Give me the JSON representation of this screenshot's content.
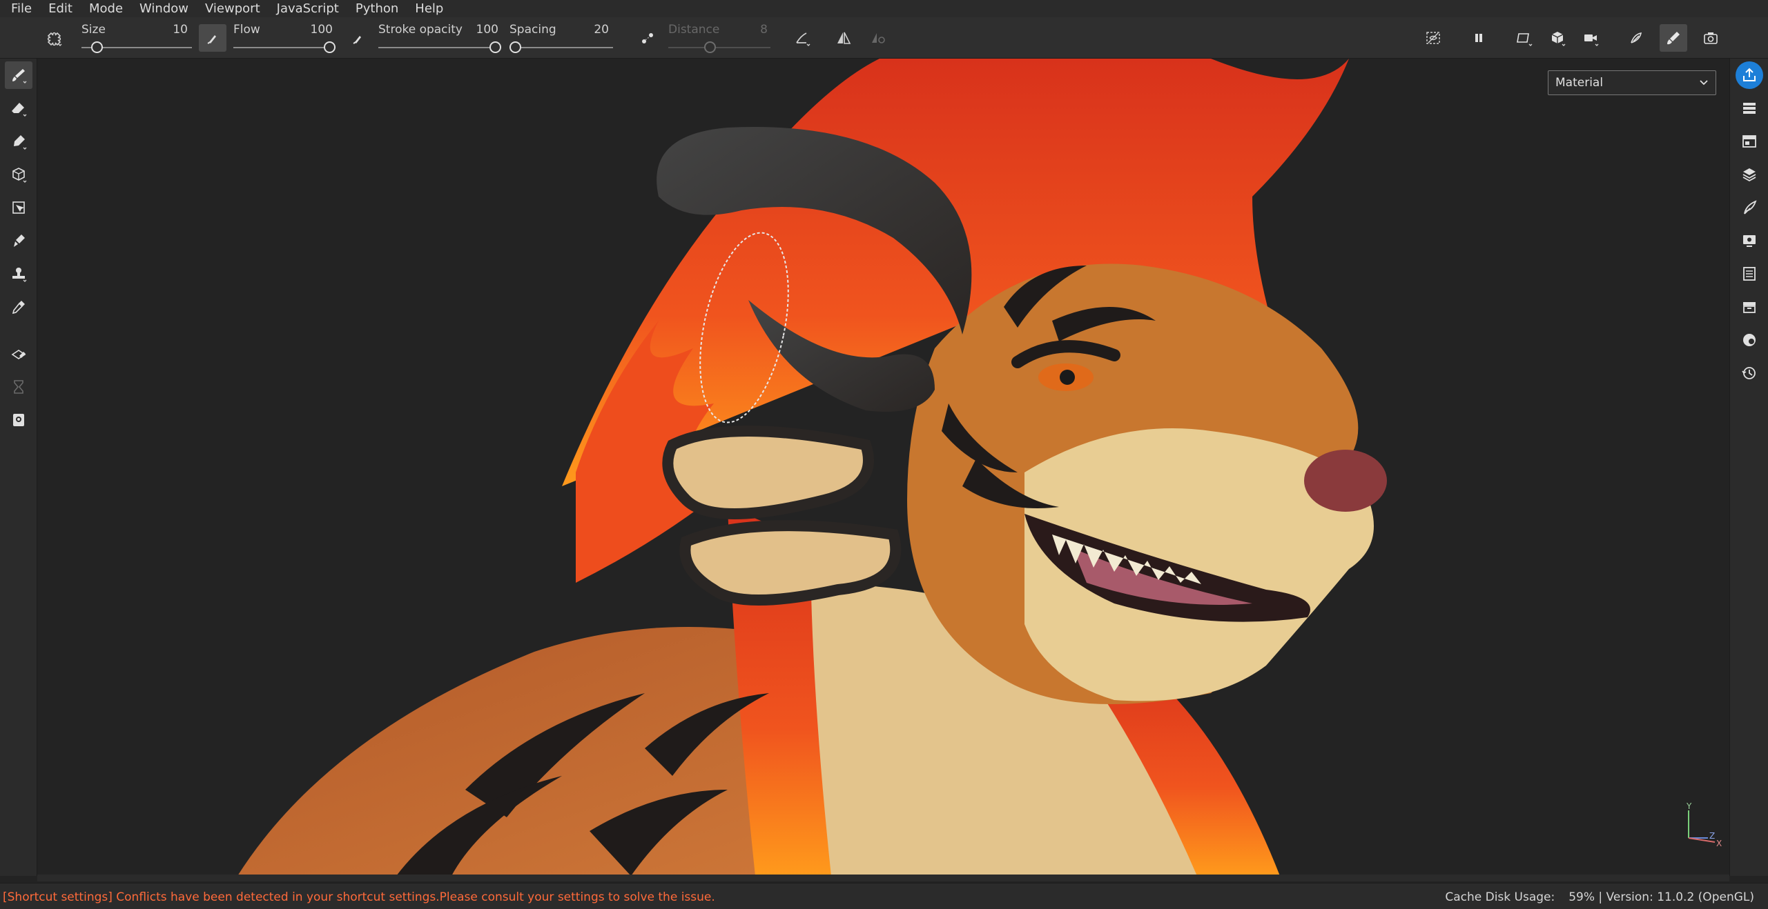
{
  "menu": [
    "File",
    "Edit",
    "Mode",
    "Window",
    "Viewport",
    "JavaScript",
    "Python",
    "Help"
  ],
  "toolbar": {
    "size_label": "Size",
    "size_value": "10",
    "size_fraction": 0.1,
    "flow_label": "Flow",
    "flow_value": "100",
    "flow_fraction": 1.0,
    "opacity_label": "Stroke opacity",
    "opacity_value": "100",
    "opacity_fraction": 1.0,
    "spacing_label": "Spacing",
    "spacing_value": "20",
    "spacing_fraction": 0.0,
    "distance_label": "Distance",
    "distance_value": "8",
    "distance_fraction": 0.4
  },
  "viewport": {
    "view_mode_select": "Material",
    "axis_y": "Y",
    "axis_x": "X",
    "axis_z": "Z"
  },
  "status": {
    "message": "[Shortcut settings] Conflicts have been detected in your shortcut settings.Please consult your settings to solve the issue.",
    "cache_label": "Cache Disk Usage:",
    "cache_info": "59% | Version: 11.0.2 (OpenGL)"
  },
  "colors": {
    "accent": "#1d7fd8",
    "status_error": "#ff6a3a",
    "fur_orange": "#c4692e",
    "hair_red": "#e8451c",
    "skin_cream": "#e6c98f",
    "horn_dark": "#3a3533"
  }
}
